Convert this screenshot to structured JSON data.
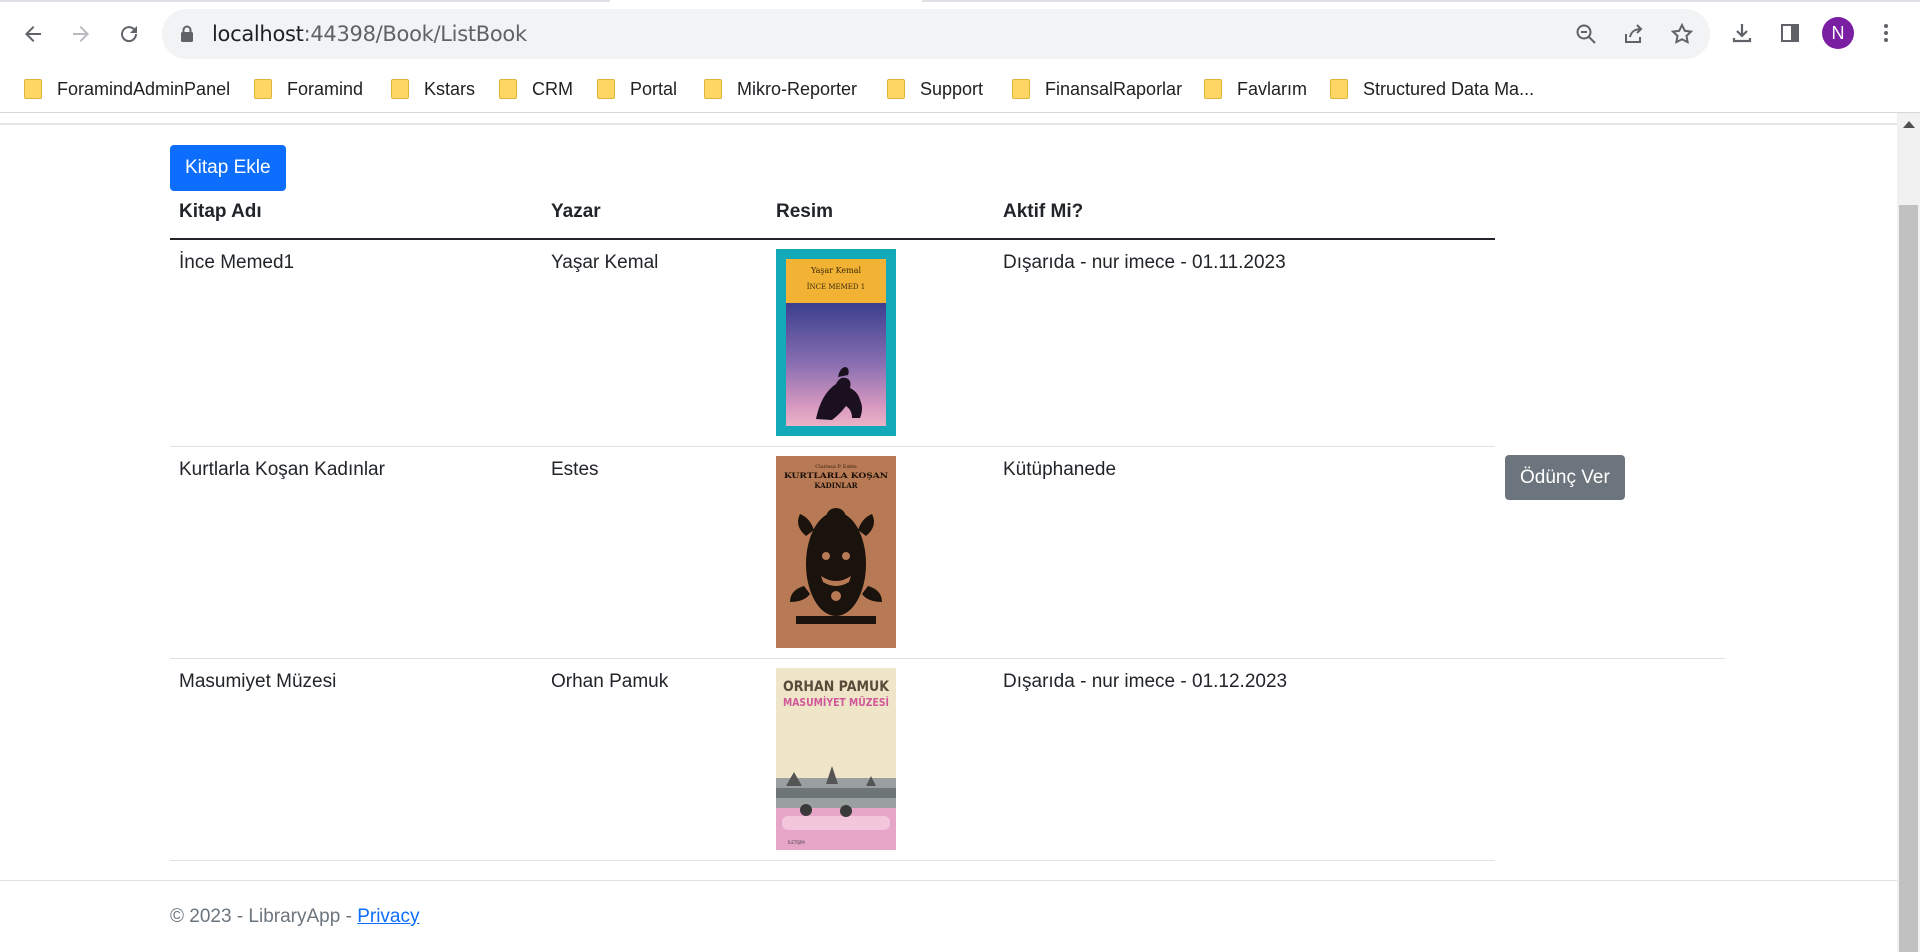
{
  "browser": {
    "url_host": "localhost",
    "url_path": ":44398/Book/ListBook",
    "profile_initial": "N",
    "bookmarks": [
      "ForamindAdminPanel",
      "Foramind",
      "Kstars",
      "CRM",
      "Portal",
      "Mikro-Reporter",
      "Support",
      "FinansalRaporlar",
      "Favlarım",
      "Structured Data Ma..."
    ]
  },
  "page": {
    "add_button": "Kitap Ekle",
    "headers": {
      "name": "Kitap Adı",
      "author": "Yazar",
      "image": "Resim",
      "active": "Aktif Mi?"
    },
    "rows": [
      {
        "name": "İnce Memed1",
        "author": "Yaşar Kemal",
        "status": "Dışarıda - nur imece - 01.11.2023",
        "cover": {
          "top_text": "Yaşar Kemal",
          "title": "İNCE MEMED 1"
        }
      },
      {
        "name": "Kurtlarla Koşan Kadınlar",
        "author": "Estes",
        "status": "Kütüphanede",
        "action": "Ödünç Ver",
        "cover": {
          "top_text": "Clarissa P. Estés",
          "title": "KURTLARLA KOŞAN KADINLAR"
        }
      },
      {
        "name": "Masumiyet Müzesi",
        "author": "Orhan Pamuk",
        "status": "Dışarıda - nur imece - 01.12.2023",
        "cover": {
          "top_text": "ORHAN PAMUK",
          "title": "MASUMİYET MÜZESİ"
        }
      }
    ],
    "footer": {
      "text": "© 2023 - LibraryApp - ",
      "link": "Privacy"
    }
  },
  "colors": {
    "primary": "#0d6efd",
    "secondary": "#6c757d",
    "avatar": "#7b1fa2"
  }
}
